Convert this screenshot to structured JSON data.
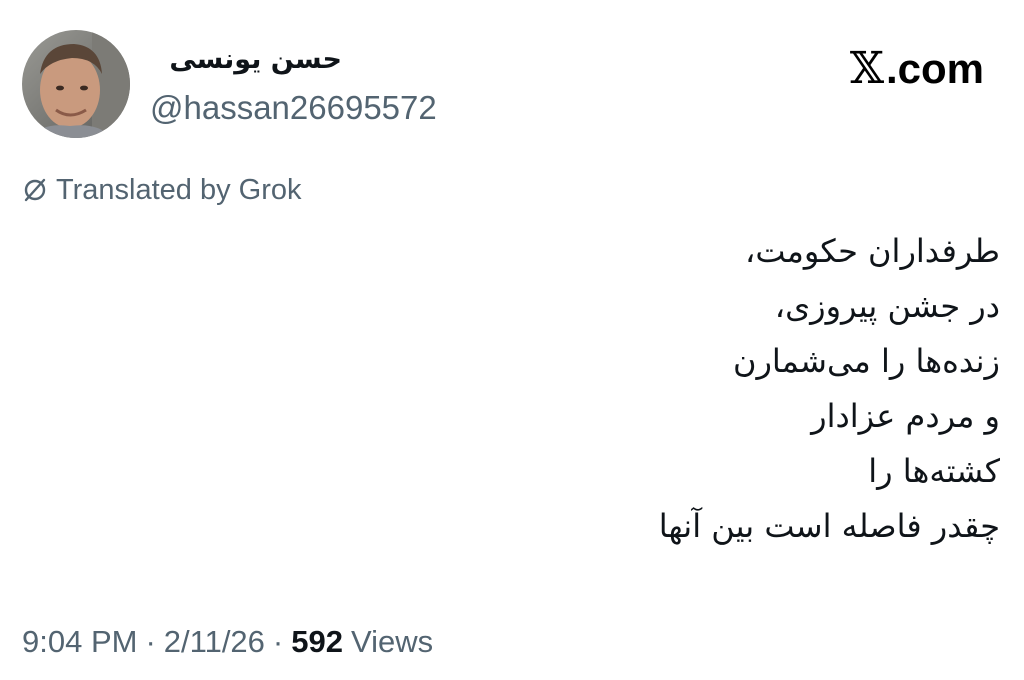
{
  "author": {
    "display_name": "حسن یونسی",
    "handle": "@hassan26695572",
    "avatar_icon": "profile-photo"
  },
  "brand": {
    "logo_icon": "x-logo-icon",
    "label": ".com"
  },
  "translation": {
    "icon": "translate-icon",
    "label": "Translated by Grok"
  },
  "tweet": {
    "lines": [
      "طرفداران حکومت،",
      "در جشن پیروزی،",
      "زنده‌ها را می‌شمارن",
      "و مردم عزادار",
      "کشته‌ها را",
      "چقدر فاصله است بین آنها"
    ]
  },
  "meta": {
    "time": "9:04 PM",
    "date": "2/11/26",
    "separator": "·",
    "views_count": "592",
    "views_label": "Views"
  },
  "colors": {
    "text_primary": "#0f1419",
    "text_secondary": "#536471",
    "background": "#ffffff"
  }
}
